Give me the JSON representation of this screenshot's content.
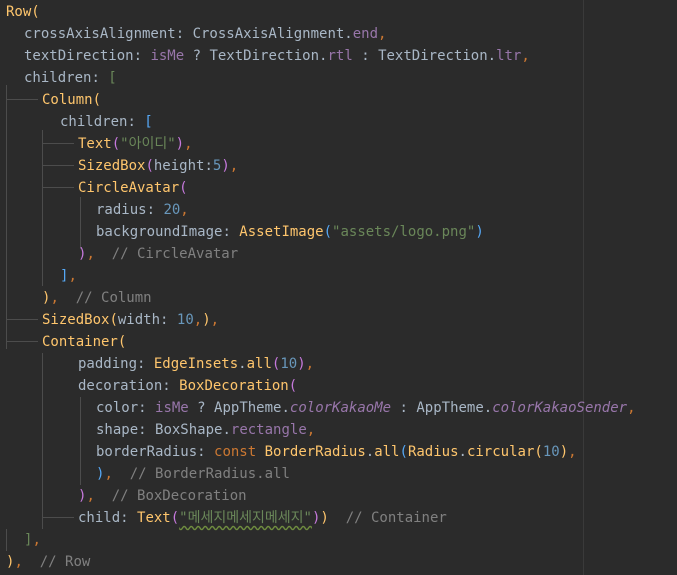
{
  "editor": {
    "lines": [
      "Row(",
      "crossAxisAlignment: CrossAxisAlignment.end,",
      "textDirection: isMe ? TextDirection.rtl : TextDirection.ltr,",
      "children: [",
      "Column(",
      "children: [",
      "Text(\"아이디\"),",
      "SizedBox(height:5),",
      "CircleAvatar(",
      "radius: 20,",
      "backgroundImage: AssetImage(\"assets/logo.png\")",
      "),  // CircleAvatar",
      "],",
      "),  // Column",
      "SizedBox(width: 10,),",
      "Container(",
      "padding: EdgeInsets.all(10),",
      "decoration: BoxDecoration(",
      "color: isMe ? AppTheme.colorKakaoMe : AppTheme.colorKakaoSender,",
      "shape: BoxShape.rectangle,",
      "borderRadius: const BorderRadius.all(Radius.circular(10),",
      "),  // BorderRadius.all",
      "),  // BoxDecoration",
      "child: Text(\"메세지메세지메세지\"))  // Container",
      "],",
      "),  // Row"
    ],
    "tokens": {
      "row": "Row",
      "cross_axis_alignment": "crossAxisAlignment",
      "cross_axis_alignment_cls": "CrossAxisAlignment",
      "end": "end",
      "text_direction": "textDirection",
      "is_me": "isMe",
      "text_direction_cls": "TextDirection",
      "rtl": "rtl",
      "ltr": "ltr",
      "children": "children",
      "column": "Column",
      "text": "Text",
      "id_string": "\"아이디\"",
      "sized_box": "SizedBox",
      "height": "height",
      "five": "5",
      "circle_avatar": "CircleAvatar",
      "radius": "radius",
      "twenty": "20",
      "background_image": "backgroundImage",
      "asset_image": "AssetImage",
      "asset_path": "\"assets/logo.png\"",
      "cmt_circle_avatar": "// CircleAvatar",
      "cmt_column": "// Column",
      "width": "width",
      "ten": "10",
      "container": "Container",
      "padding": "padding",
      "edge_insets": "EdgeInsets",
      "all": "all",
      "decoration": "decoration",
      "box_decoration": "BoxDecoration",
      "color": "color",
      "app_theme": "AppTheme",
      "color_kakao_me": "colorKakaoMe",
      "color_kakao_sender": "colorKakaoSender",
      "shape": "shape",
      "box_shape": "BoxShape",
      "rectangle": "rectangle",
      "border_radius": "borderRadius",
      "const": "const",
      "border_radius_cls": "BorderRadius",
      "radius_cls": "Radius",
      "circular": "circular",
      "cmt_border_radius_all": "// BorderRadius.all",
      "cmt_box_decoration": "// BoxDecoration",
      "child": "child",
      "message_string": "\"메세지메세지메세지\"",
      "cmt_container": "// Container",
      "cmt_row": "// Row"
    },
    "colors": {
      "background": "#2b2b2b",
      "default_text": "#a9b7c6",
      "class": "#ffc66d",
      "keyword": "#cc7832",
      "number": "#6897bb",
      "string": "#6a8759",
      "comment": "#808080",
      "static_field": "#9876aa"
    }
  }
}
